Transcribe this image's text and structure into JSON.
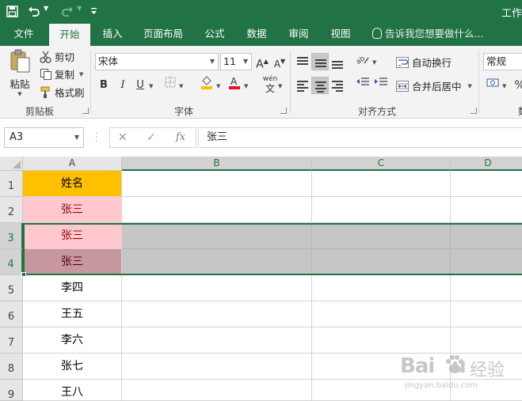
{
  "titlebar": {
    "title": "工作",
    "save_icon": "save-icon",
    "undo_icon": "undo-icon",
    "redo_icon": "redo-icon",
    "customize_icon": "customize-qat-icon"
  },
  "tabs": [
    {
      "label": "文件"
    },
    {
      "label": "开始"
    },
    {
      "label": "插入"
    },
    {
      "label": "页面布局"
    },
    {
      "label": "公式"
    },
    {
      "label": "数据"
    },
    {
      "label": "审阅"
    },
    {
      "label": "视图"
    }
  ],
  "tell_me": "告诉我您想要做什么...",
  "ribbon": {
    "clipboard": {
      "paste": "粘贴",
      "cut": "剪切",
      "copy": "复制",
      "format_painter": "格式刷",
      "group": "剪贴板"
    },
    "font": {
      "font_name": "宋体",
      "font_size": "11",
      "grow": "A",
      "shrink": "A",
      "bold": "B",
      "italic": "I",
      "underline": "U",
      "wen": "wén",
      "wen_char": "文",
      "group": "字体"
    },
    "alignment": {
      "wrap": "自动换行",
      "merge": "合并后居中",
      "group": "对齐方式"
    },
    "number": {
      "format": "常规",
      "percent": "%",
      "group": "数"
    }
  },
  "formula_bar": {
    "name_box": "A3",
    "cancel": "✕",
    "enter": "✓",
    "fx": "fx",
    "content": "张三"
  },
  "sheet": {
    "columns": [
      "A",
      "B",
      "C",
      "D"
    ],
    "rows": [
      {
        "num": "1",
        "a": "姓名"
      },
      {
        "num": "2",
        "a": "张三"
      },
      {
        "num": "3",
        "a": "张三"
      },
      {
        "num": "4",
        "a": "张三"
      },
      {
        "num": "5",
        "a": "李四"
      },
      {
        "num": "6",
        "a": "王五"
      },
      {
        "num": "7",
        "a": "李六"
      },
      {
        "num": "8",
        "a": "张七"
      },
      {
        "num": "9",
        "a": "王八"
      }
    ]
  },
  "colors": {
    "excel_green": "#217346",
    "header_fill": "#FFC000",
    "dup_fill": "#FFC7CE",
    "dup_text": "#9C0006",
    "selection_gray": "#C6C6C6"
  },
  "watermark": {
    "brand": "Bai",
    "brand_tail": "u",
    "cn": "经验",
    "url": "jingyan.baidu.com"
  }
}
